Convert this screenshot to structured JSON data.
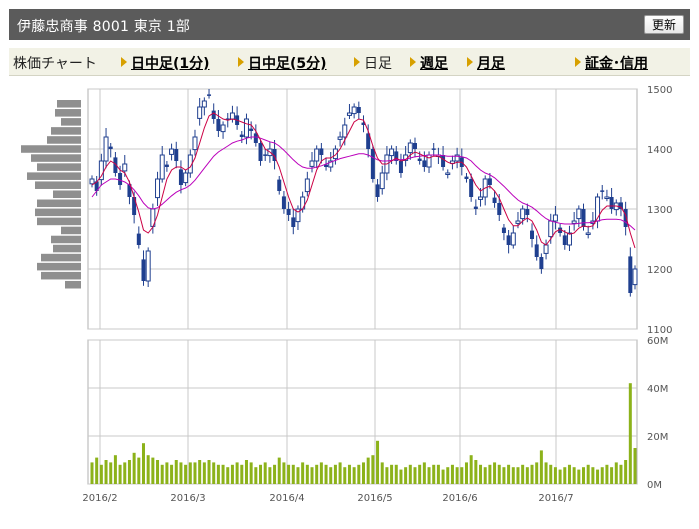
{
  "header": {
    "title": "伊藤忠商事  8001  東京 1部",
    "refresh_label": "更新"
  },
  "nav": {
    "chart_label": "株価チャート",
    "items": [
      {
        "label": "日中足(1分)",
        "link": true
      },
      {
        "label": "日中足(5分)",
        "link": true
      },
      {
        "label": "日足",
        "link": false
      },
      {
        "label": "週足",
        "link": true
      },
      {
        "label": "月足",
        "link": true
      },
      {
        "label": "証金･信用",
        "link": true
      }
    ]
  },
  "colors": {
    "candle": "#1f3f8f",
    "ma_short": "#cc0044",
    "ma_long": "#bb00bb",
    "volume": "#8cb21a",
    "grid": "#c8c8c8",
    "profile": "#8f8f8f"
  },
  "chart_data": {
    "type": "line",
    "price_axis": {
      "min": 1100,
      "max": 1500,
      "ticks": [
        1100,
        1200,
        1300,
        1400,
        1500
      ]
    },
    "volume_axis": {
      "min": 0,
      "max": 60,
      "unit": "M",
      "ticks": [
        "0M",
        "20M",
        "40M",
        "60M"
      ]
    },
    "x_ticks": [
      "2016/2",
      "2016/3",
      "2016/4",
      "2016/5",
      "2016/6",
      "2016/7"
    ],
    "close": [
      1350,
      1330,
      1380,
      1420,
      1400,
      1360,
      1340,
      1375,
      1320,
      1290,
      1240,
      1180,
      1230,
      1300,
      1350,
      1390,
      1370,
      1400,
      1380,
      1340,
      1360,
      1390,
      1420,
      1470,
      1480,
      1490,
      1450,
      1430,
      1440,
      1450,
      1460,
      1440,
      1420,
      1450,
      1430,
      1410,
      1380,
      1390,
      1400,
      1380,
      1330,
      1300,
      1290,
      1270,
      1300,
      1320,
      1350,
      1380,
      1400,
      1390,
      1370,
      1380,
      1400,
      1420,
      1440,
      1460,
      1470,
      1460,
      1440,
      1400,
      1350,
      1320,
      1360,
      1390,
      1400,
      1380,
      1360,
      1390,
      1410,
      1400,
      1380,
      1370,
      1390,
      1400,
      1390,
      1370,
      1360,
      1380,
      1390,
      1370,
      1350,
      1320,
      1300,
      1320,
      1350,
      1340,
      1310,
      1290,
      1260,
      1240,
      1260,
      1280,
      1300,
      1290,
      1250,
      1220,
      1200,
      1240,
      1280,
      1290,
      1260,
      1240,
      1260,
      1280,
      1300,
      1270,
      1260,
      1280,
      1320,
      1330,
      1320,
      1300,
      1310,
      1300,
      1270,
      1160,
      1200
    ],
    "ma_short": [
      1340,
      1345,
      1355,
      1370,
      1380,
      1375,
      1365,
      1360,
      1345,
      1320,
      1295,
      1265,
      1260,
      1270,
      1290,
      1320,
      1350,
      1365,
      1370,
      1370,
      1365,
      1370,
      1385,
      1410,
      1435,
      1455,
      1460,
      1455,
      1450,
      1448,
      1450,
      1448,
      1445,
      1442,
      1440,
      1430,
      1415,
      1400,
      1395,
      1388,
      1370,
      1345,
      1320,
      1300,
      1295,
      1300,
      1315,
      1340,
      1365,
      1380,
      1385,
      1385,
      1390,
      1400,
      1415,
      1430,
      1445,
      1450,
      1448,
      1430,
      1405,
      1385,
      1375,
      1375,
      1380,
      1385,
      1380,
      1382,
      1390,
      1395,
      1392,
      1388,
      1385,
      1388,
      1388,
      1383,
      1378,
      1375,
      1378,
      1378,
      1370,
      1355,
      1340,
      1330,
      1335,
      1338,
      1330,
      1318,
      1300,
      1282,
      1272,
      1272,
      1280,
      1285,
      1280,
      1265,
      1245,
      1240,
      1250,
      1262,
      1266,
      1262,
      1258,
      1260,
      1268,
      1272,
      1270,
      1272,
      1285,
      1298,
      1305,
      1305,
      1305,
      1303,
      1290,
      1260,
      1235
    ],
    "ma_long": [
      1320,
      1330,
      1340,
      1345,
      1350,
      1350,
      1348,
      1345,
      1340,
      1332,
      1322,
      1310,
      1302,
      1300,
      1302,
      1308,
      1315,
      1322,
      1328,
      1332,
      1335,
      1340,
      1348,
      1358,
      1368,
      1378,
      1388,
      1395,
      1400,
      1405,
      1410,
      1413,
      1415,
      1418,
      1420,
      1420,
      1418,
      1415,
      1412,
      1410,
      1405,
      1398,
      1390,
      1382,
      1375,
      1370,
      1368,
      1368,
      1370,
      1372,
      1375,
      1378,
      1381,
      1384,
      1386,
      1388,
      1390,
      1392,
      1392,
      1390,
      1386,
      1382,
      1380,
      1380,
      1381,
      1382,
      1382,
      1383,
      1385,
      1387,
      1388,
      1389,
      1390,
      1390,
      1390,
      1389,
      1388,
      1388,
      1388,
      1387,
      1385,
      1380,
      1372,
      1365,
      1360,
      1357,
      1352,
      1345,
      1338,
      1330,
      1322,
      1315,
      1310,
      1307,
      1303,
      1297,
      1290,
      1284,
      1280,
      1278,
      1276,
      1275,
      1275,
      1275,
      1276,
      1277,
      1277,
      1278,
      1280,
      1282,
      1283,
      1283,
      1283,
      1282,
      1278,
      1272,
      1265
    ],
    "volume": [
      9,
      11,
      8,
      10,
      9,
      12,
      8,
      9,
      10,
      13,
      11,
      17,
      12,
      11,
      10,
      8,
      9,
      8,
      10,
      9,
      8,
      9,
      9,
      10,
      9,
      10,
      9,
      8,
      8,
      7,
      8,
      9,
      8,
      10,
      9,
      7,
      8,
      9,
      7,
      8,
      11,
      9,
      8,
      8,
      7,
      9,
      8,
      7,
      8,
      9,
      8,
      7,
      8,
      9,
      7,
      8,
      7,
      8,
      9,
      11,
      12,
      18,
      9,
      7,
      8,
      8,
      6,
      7,
      8,
      7,
      8,
      9,
      7,
      8,
      8,
      6,
      7,
      8,
      7,
      7,
      9,
      12,
      10,
      8,
      7,
      8,
      9,
      8,
      7,
      8,
      7,
      7,
      8,
      7,
      8,
      9,
      14,
      9,
      8,
      7,
      6,
      7,
      8,
      7,
      6,
      7,
      8,
      7,
      6,
      7,
      8,
      7,
      9,
      8,
      10,
      42,
      15
    ],
    "price_profile": [
      12,
      13,
      10,
      15,
      17,
      30,
      25,
      22,
      27,
      23,
      14,
      22,
      23,
      22,
      10,
      15,
      14,
      20,
      22,
      20,
      8
    ]
  }
}
